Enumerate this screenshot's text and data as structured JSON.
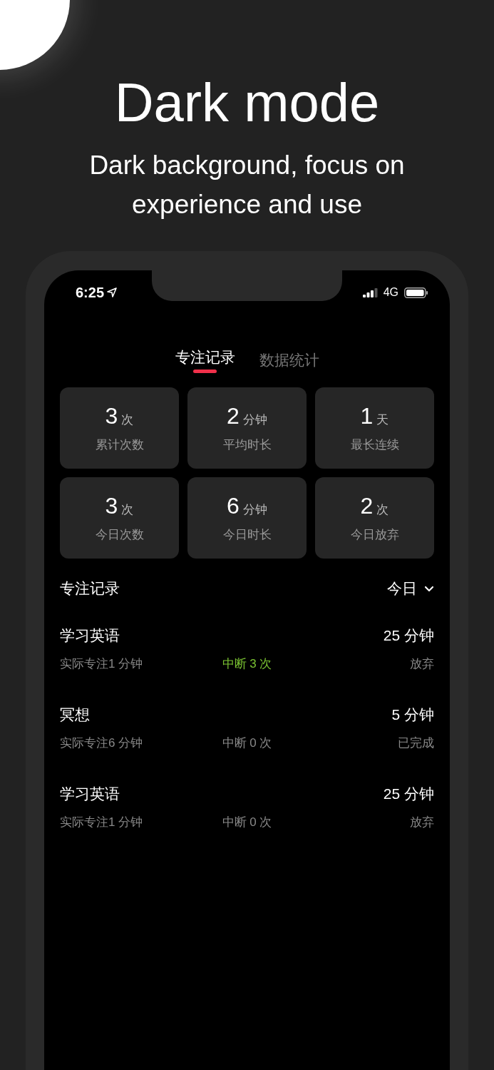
{
  "headline": {
    "title": "Dark mode",
    "subtitle": "Dark background, focus on experience and use"
  },
  "status_bar": {
    "time": "6:25",
    "network": "4G"
  },
  "tabs": [
    {
      "label": "专注记录",
      "selected": true
    },
    {
      "label": "数据统计",
      "selected": false
    }
  ],
  "stats": [
    {
      "value": "3",
      "unit": "次",
      "label": "累计次数"
    },
    {
      "value": "2",
      "unit": "分钟",
      "label": "平均时长"
    },
    {
      "value": "1",
      "unit": "天",
      "label": "最长连续"
    },
    {
      "value": "3",
      "unit": "次",
      "label": "今日次数"
    },
    {
      "value": "6",
      "unit": "分钟",
      "label": "今日时长"
    },
    {
      "value": "2",
      "unit": "次",
      "label": "今日放弃"
    }
  ],
  "records_header": {
    "title": "专注记录",
    "filter": "今日"
  },
  "records": [
    {
      "name": "学习英语",
      "planned": "25 分钟",
      "actual": "实际专注1 分钟",
      "interruptions": "中断 3 次",
      "alert": true,
      "status": "放弃"
    },
    {
      "name": "冥想",
      "planned": "5 分钟",
      "actual": "实际专注6 分钟",
      "interruptions": "中断 0 次",
      "alert": false,
      "status": "已完成"
    },
    {
      "name": "学习英语",
      "planned": "25 分钟",
      "actual": "实际专注1 分钟",
      "interruptions": "中断 0 次",
      "alert": false,
      "status": "放弃"
    }
  ]
}
